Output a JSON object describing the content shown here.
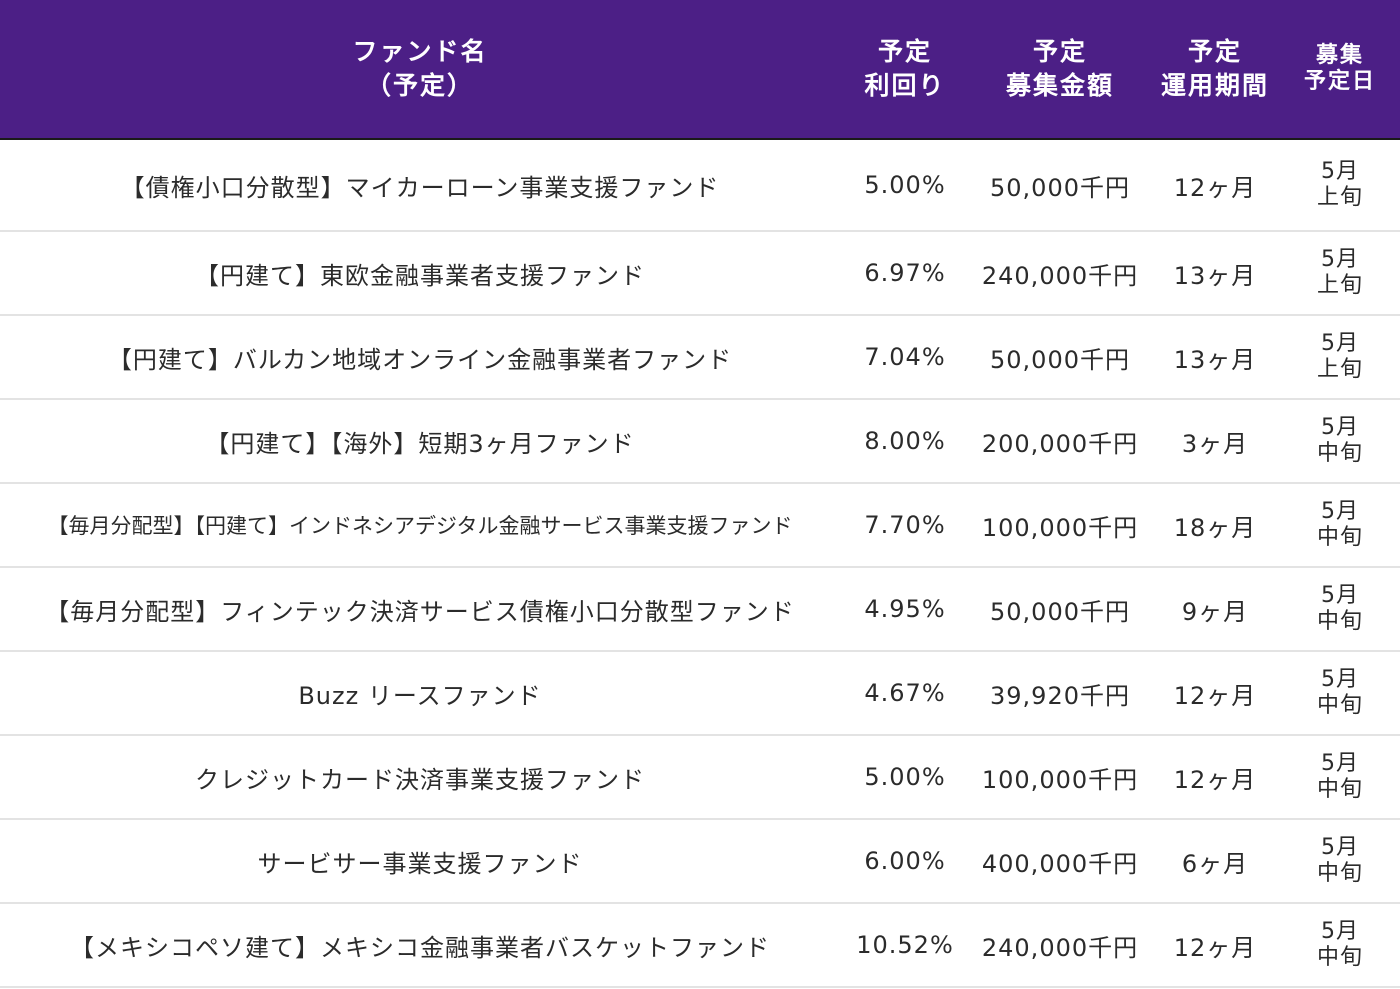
{
  "header": {
    "name": [
      "ファンド名",
      "（予定）"
    ],
    "yield": [
      "予定",
      "利回り"
    ],
    "amount": [
      "予定",
      "募集金額"
    ],
    "period": [
      "予定",
      "運用期間"
    ],
    "date": [
      "募集",
      "予定日"
    ]
  },
  "rows": [
    {
      "name": "【債権小口分散型】マイカーローン事業支援ファンド",
      "yield": "5.00%",
      "amount": "50,000千円",
      "period": "12ヶ月",
      "month": "5月",
      "part": "上旬"
    },
    {
      "name": "【円建て】東欧金融事業者支援ファンド",
      "yield": "6.97%",
      "amount": "240,000千円",
      "period": "13ヶ月",
      "month": "5月",
      "part": "上旬"
    },
    {
      "name": "【円建て】バルカン地域オンライン金融事業者ファンド",
      "yield": "7.04%",
      "amount": "50,000千円",
      "period": "13ヶ月",
      "month": "5月",
      "part": "上旬"
    },
    {
      "name": "【円建て】【海外】短期3ヶ月ファンド",
      "yield": "8.00%",
      "amount": "200,000千円",
      "period": "3ヶ月",
      "month": "5月",
      "part": "中旬"
    },
    {
      "name": "【毎月分配型】【円建て】インドネシアデジタル金融サービス事業支援ファンド",
      "yield": "7.70%",
      "amount": "100,000千円",
      "period": "18ヶ月",
      "month": "5月",
      "part": "中旬"
    },
    {
      "name": "【毎月分配型】フィンテック決済サービス債権小口分散型ファンド",
      "yield": "4.95%",
      "amount": "50,000千円",
      "period": "9ヶ月",
      "month": "5月",
      "part": "中旬"
    },
    {
      "name": "Buzz リースファンド",
      "yield": "4.67%",
      "amount": "39,920千円",
      "period": "12ヶ月",
      "month": "5月",
      "part": "中旬"
    },
    {
      "name": "クレジットカード決済事業支援ファンド",
      "yield": "5.00%",
      "amount": "100,000千円",
      "period": "12ヶ月",
      "month": "5月",
      "part": "中旬"
    },
    {
      "name": "サービサー事業支援ファンド",
      "yield": "6.00%",
      "amount": "400,000千円",
      "period": "6ヶ月",
      "month": "5月",
      "part": "中旬"
    },
    {
      "name": "【メキシコペソ建て】メキシコ金融事業者バスケットファンド",
      "yield": "10.52%",
      "amount": "240,000千円",
      "period": "12ヶ月",
      "month": "5月",
      "part": "中旬"
    }
  ],
  "colors": {
    "header_bg": "#4c1f86",
    "header_text": "#ffffff",
    "row_divider": "#e3e3e3"
  }
}
